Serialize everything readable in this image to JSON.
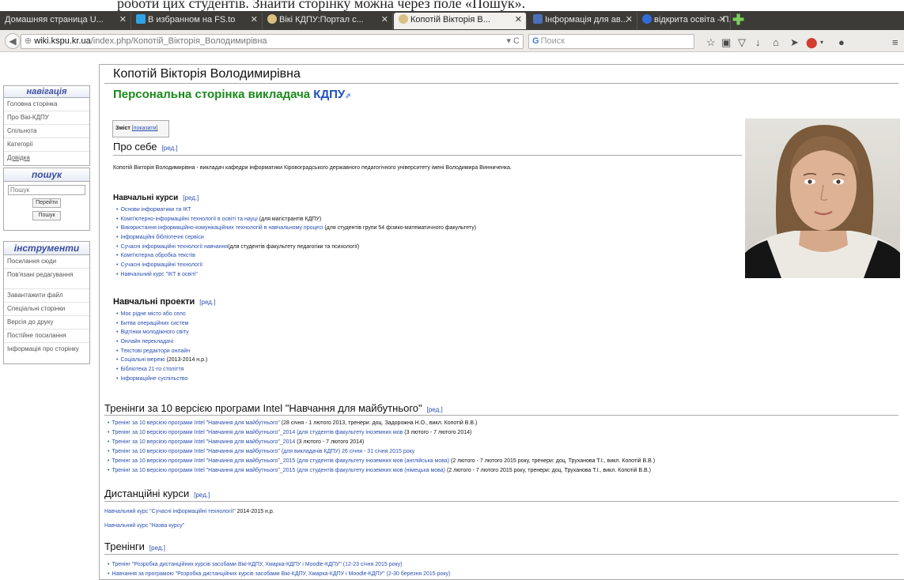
{
  "top_strip": "роботи цих студентів. Знайти сторінку можна через поле «Пошук».",
  "browser": {
    "tabs": [
      {
        "title": "Домашняя страница U...",
        "icon_color": "#e0e0e0"
      },
      {
        "title": "В избранном на FS.to",
        "icon_color": "#2fa3e6"
      },
      {
        "title": "Вікі КДПУ:Портал с...",
        "icon_color": "#d8c083"
      },
      {
        "title": "Копотій Вікторія В...",
        "icon_color": "#d8c083"
      },
      {
        "title": "Інформація для ав...",
        "icon_color": "#4d6fb8"
      },
      {
        "title": "відкрита освіта - П...",
        "icon_color": "#2f6ed8"
      }
    ],
    "url_domain": "wiki.kspu.kr.ua",
    "url_path": "/index.php/Копотій_Вікторія_Володимирівна",
    "search_placeholder": "Поиск",
    "toolbar_icons": [
      "star-icon",
      "reading-list-icon",
      "pocket-icon",
      "download-icon",
      "home-icon",
      "send-icon",
      "adblock-icon",
      "chat-icon",
      "menu-icon"
    ]
  },
  "sidebar": {
    "nav_title": "навігація",
    "nav_items": [
      "Головна сторінка",
      "Про Вікі-КДПУ",
      "Спільнота",
      "Категорії",
      "Довідка"
    ],
    "search_title": "пошук",
    "search_placeholder": "Пошук",
    "go_button": "Перейти",
    "search_button": "Пошук",
    "tools_title": "інструменти",
    "tools_items": [
      "Посилання сюди",
      "Пов'язані редагування",
      "Завантажити файл",
      "Спеціальні сторінки",
      "Версія до друку",
      "Постійне посилання",
      "Інформація про сторінку"
    ]
  },
  "content": {
    "title": "Копотій Вікторія Володимирівна",
    "subtitle_prefix": "Персональна сторінка викладача ",
    "subtitle_link": "КДПУ",
    "toc_label": "Зміст",
    "toc_show": "[показати]",
    "edit_label": "[ред.]",
    "about_heading": "Про себе",
    "about_text": "Копотій Вікторія Володимирівна - викладач кафедри інформатики Кіровоградського державного педагогічного університету імені Володимира Винниченка.",
    "courses_heading": "Навчальні курси",
    "courses": [
      {
        "link": "Основи інформатики та ІКТ",
        "note": ""
      },
      {
        "link": "Комп'ютерно-інформаційні технології в освіті та науці",
        "note": " (для магістрантів КДПУ)"
      },
      {
        "link": "Використання інформаційно-комунікаційних технологій в навчальному процесі",
        "note": " (для студентів групи 54 фізико-математичного факультету)"
      },
      {
        "link": "Інформаційні бібліотечні сервіси",
        "note": ""
      },
      {
        "link": "Сучасні інформаційні технології навчання",
        "note": "(для студентів факультету педагогіки та психології)"
      },
      {
        "link": "Комп'ютерна обробка текстів",
        "note": ""
      },
      {
        "link": "Сучасні інформаційні технології",
        "note": ""
      },
      {
        "link": "Навчальний курс \"ІКТ в освіті\"",
        "note": ""
      }
    ],
    "projects_heading": "Навчальні проекти",
    "projects": [
      {
        "link": "Моє рідне місто або село",
        "note": ""
      },
      {
        "link": "Битва операційних систем",
        "note": ""
      },
      {
        "link": "Відтінки молодіжного світу",
        "note": ""
      },
      {
        "link": "Онлайн перекладачі",
        "note": ""
      },
      {
        "link": "Текстові редактори онлайн",
        "note": ""
      },
      {
        "link": "Соціальні мережі",
        "note": " (2013-2014 н.р.)"
      },
      {
        "link": "Бібліотека 21-го століття",
        "note": ""
      },
      {
        "link": "Інформаційне суспільство",
        "note": ""
      }
    ],
    "trainings_intel_heading": "Тренінги за 10 версією програми Intel \"Навчання для майбутнього\"",
    "trainings_intel": [
      {
        "link": "Тренінг за 10 версією програми Intel \"Навчання для майбутнього\"",
        "note": " (28 січня - 1 лютого 2013, тренери: доц. Задорожна Н.О., викл. Копотій В.В.)"
      },
      {
        "link": "Тренінг за 10 версією програми Intel \"Навчання для майбутнього\"_2014 (для студентів факультету іноземних мов",
        "note": " (3 лютого - 7 лютого 2014)"
      },
      {
        "link": "Тренінг за 10 версією програми Intel \"Навчання для майбутнього\"_2014",
        "note": " (3 лютого - 7 лютого 2014)"
      },
      {
        "link": "Тренінг за 10 версією програми Intel \"Навчання для майбутнього\" (для викладачів КДПУ) 26 січня - 31 січня 2015 року",
        "note": ""
      },
      {
        "link": "Тренінг за 10 версією програми Intel \"Навчання для майбутнього\"_2015 (для студентів факультету іноземних мов (англійська мова)",
        "note": " (2 лютого - 7 лютого 2015 року, тренери: доц. Труханова Т.І., викл. Копотій В.В.)"
      },
      {
        "link": "Тренінг за 10 версією програми Intel \"Навчання для майбутнього\"_2015 (для студентів факультету іноземних мов (німецька мова)",
        "note": " (2 лютого - 7 лютого 2015 року, тренери: доц. Труханова Т.І., викл. Копотій В.В.)"
      }
    ],
    "distance_heading": "Дистанційні курси",
    "distance_line1_link": "Навчальний курс \"Сучасні інформаційні технології\"",
    "distance_line1_note": " 2014-2015 н.р.",
    "distance_line2_link": "Навчальний курс \"Назва курсу\"",
    "trainings_heading": "Тренінги",
    "trainings": [
      {
        "link": "Тренінг \"Розробка дистанційних курсів засобами Вікі-КДПУ, Хмарка-КДПУ і Moodle-КДПУ\" (12-23 січня 2015 року)",
        "note": ""
      },
      {
        "link": "Навчання за програмою \"Розробка дистанційних курсів засобами Вікі-КДПУ, Хмарка-КДПУ і Moodle-КДПУ\" (2-30 березня 2015 року)",
        "note": ""
      }
    ]
  }
}
